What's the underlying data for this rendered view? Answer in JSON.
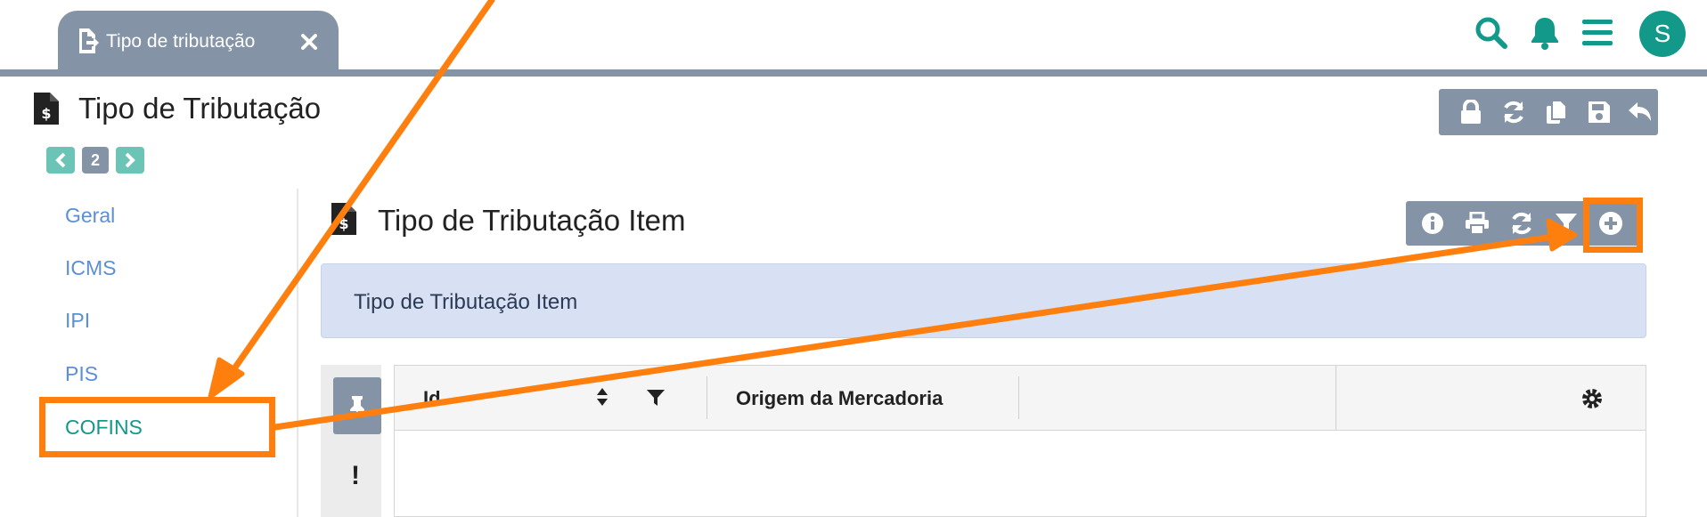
{
  "tab": {
    "label": "Tipo de tributação"
  },
  "user": {
    "initial": "S"
  },
  "page": {
    "title": "Tipo de Tributação"
  },
  "pager": {
    "current": "2"
  },
  "nav": {
    "items": [
      {
        "label": "Geral"
      },
      {
        "label": "ICMS"
      },
      {
        "label": "IPI"
      },
      {
        "label": "PIS"
      },
      {
        "label": "COFINS"
      }
    ]
  },
  "section": {
    "title": "Tipo de Tributação Item",
    "banner": "Tipo de Tributação Item"
  },
  "table": {
    "headers": [
      "Id",
      "Origem da Mercadoria"
    ]
  },
  "side_buttons": {
    "alert": "!"
  },
  "colors": {
    "accent": "#13998a",
    "toolbar": "#8494a6",
    "link": "#5b8fd6",
    "annotation": "#ff7f0e"
  }
}
